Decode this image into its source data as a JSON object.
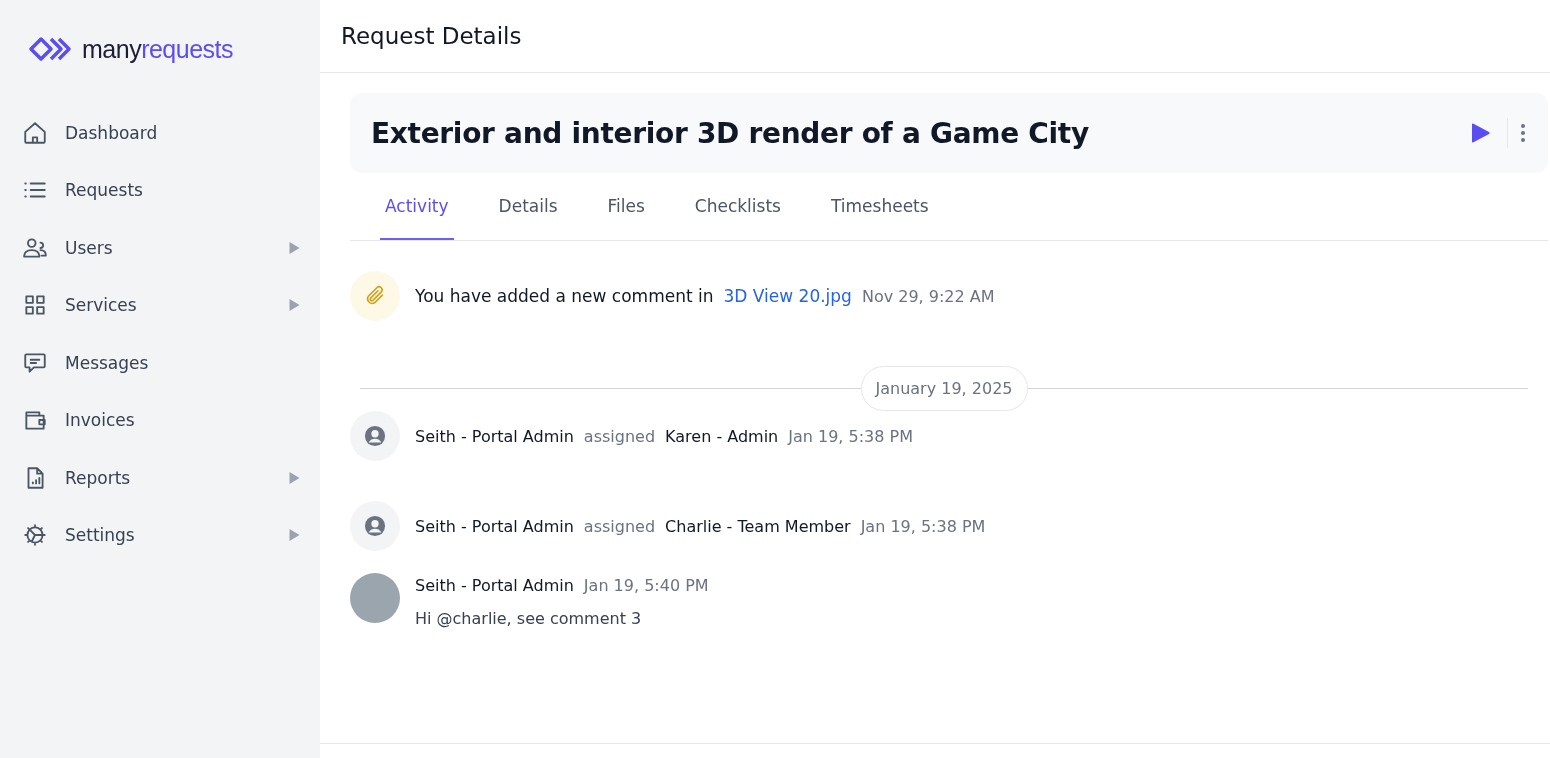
{
  "logo": {
    "prefix": "many",
    "suffix": "requests"
  },
  "sidebar": {
    "items": [
      {
        "label": "Dashboard",
        "expandable": false
      },
      {
        "label": "Requests",
        "expandable": false
      },
      {
        "label": "Users",
        "expandable": true
      },
      {
        "label": "Services",
        "expandable": true
      },
      {
        "label": "Messages",
        "expandable": false
      },
      {
        "label": "Invoices",
        "expandable": false
      },
      {
        "label": "Reports",
        "expandable": true
      },
      {
        "label": "Settings",
        "expandable": true
      }
    ]
  },
  "header": {
    "title": "Request Details"
  },
  "request": {
    "title": "Exterior and interior 3D render of a Game City"
  },
  "tabs": [
    {
      "label": "Activity",
      "selected": true
    },
    {
      "label": "Details",
      "selected": false
    },
    {
      "label": "Files",
      "selected": false
    },
    {
      "label": "Checklists",
      "selected": false
    },
    {
      "label": "Timesheets",
      "selected": false
    }
  ],
  "activity": [
    {
      "kind": "file_comment",
      "text": "You have added a new comment in",
      "link": "3D View 20.jpg",
      "time": "Nov 29, 9:22 AM"
    },
    {
      "kind": "date_divider",
      "date": "January 19, 2025"
    },
    {
      "kind": "assignment",
      "actor": "Seith - Portal Admin",
      "verb": "assigned",
      "target": "Karen - Admin",
      "time": "Jan 19, 5:38 PM"
    },
    {
      "kind": "assignment",
      "actor": "Seith - Portal Admin",
      "verb": "assigned",
      "target": "Charlie - Team Member",
      "time": "Jan 19, 5:38 PM"
    },
    {
      "kind": "comment",
      "actor": "Seith - Portal Admin",
      "time": "Jan 19, 5:40 PM",
      "body": "Hi @charlie, see comment 3"
    }
  ]
}
